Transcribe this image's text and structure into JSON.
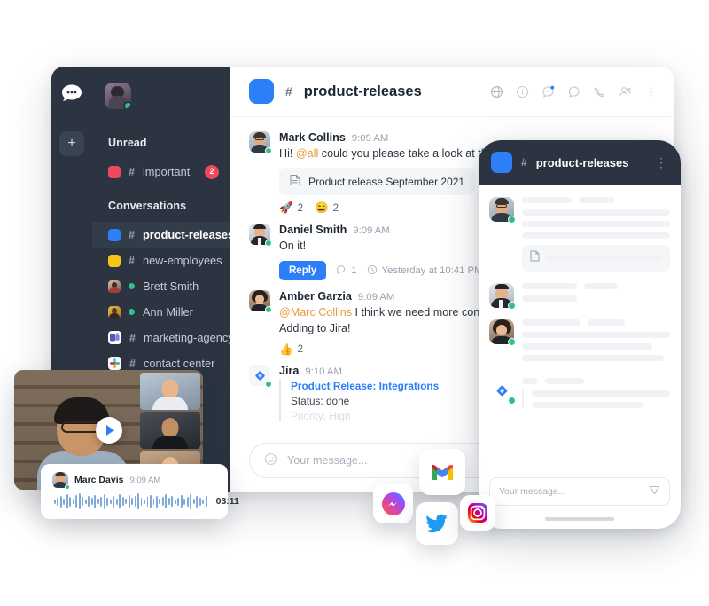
{
  "app": {
    "logo_icon": "rocket-chat-logo-icon",
    "add_button_label": "+",
    "user_avatar_name": "current-user-avatar",
    "presence": "online"
  },
  "sidebar": {
    "sections": [
      {
        "title": "Unread"
      },
      {
        "title": "Conversations"
      }
    ],
    "unread_items": [
      {
        "icon": "square-swatch",
        "color": "#f0485c",
        "prefix": "#",
        "label": "important",
        "badge": "2"
      }
    ],
    "conversation_items": [
      {
        "icon": "square-swatch",
        "color": "#2d7ff9",
        "prefix": "#",
        "label": "product-releases",
        "active": true
      },
      {
        "icon": "square-swatch",
        "color": "#f5c518",
        "prefix": "#",
        "label": "new-employees",
        "active": false
      },
      {
        "icon": "user-avatar",
        "prefix": "presence-dot",
        "label": "Brett Smith",
        "active": false
      },
      {
        "icon": "user-avatar",
        "prefix": "presence-dot",
        "label": "Ann Miller",
        "active": false
      },
      {
        "icon": "app-tile-teams",
        "prefix": "#",
        "label": "marketing-agency",
        "active": false
      },
      {
        "icon": "app-tile-slack",
        "prefix": "#",
        "label": "contact center",
        "active": false
      }
    ]
  },
  "channel_header": {
    "swatch_color": "#2d7ff9",
    "hash": "#",
    "title": "product-releases",
    "icons": [
      "globe-icon",
      "info-circle-icon",
      "chat-bubble-badge-icon",
      "chat-bubble-icon",
      "phone-icon",
      "people-icon",
      "more-vertical-icon"
    ]
  },
  "messages": [
    {
      "id": "m1",
      "author": "Mark Collins",
      "time": "9:09 AM",
      "presence": "online",
      "text_before": "Hi! ",
      "mention": "@all",
      "text_after": " could you please take a look at this",
      "attachment": {
        "icon": "document-icon",
        "label": "Product release September 2021"
      },
      "reactions": [
        {
          "emoji": "🚀",
          "name": "rocket-reaction",
          "count": "2"
        },
        {
          "emoji": "😄",
          "name": "smile-reaction",
          "count": "2"
        }
      ]
    },
    {
      "id": "m2",
      "author": "Daniel Smith",
      "time": "9:09 AM",
      "presence": "online",
      "text_before": "On it!",
      "footer": {
        "reply_label": "Reply",
        "thread_icon": "thread-icon",
        "thread_count": "1",
        "clock_icon": "clock-icon",
        "timestamp": "Yesterday at 10:41 PM"
      }
    },
    {
      "id": "m3",
      "author": "Amber Garzia",
      "time": "9:09 AM",
      "presence": "online",
      "mention": "@Marc Collins",
      "text_after": " I think we need more con",
      "second_line": "Adding to Jira!",
      "reactions": [
        {
          "emoji": "👍",
          "name": "thumbs-up-reaction",
          "count": "2"
        }
      ]
    },
    {
      "id": "m4",
      "author": "Jira",
      "time": "9:10 AM",
      "presence": "online",
      "avatar_icon": "jira-icon",
      "card": {
        "link": "Product Release: Integrations",
        "status": "Status: done",
        "priority": "Priority: High"
      }
    }
  ],
  "composer": {
    "emoji_icon": "emoji-smiley-icon",
    "placeholder": "Your message..."
  },
  "phone": {
    "header": {
      "swatch_color": "#2d7ff9",
      "hash": "#",
      "title": "product-releases",
      "more_icon": "more-vertical-icon"
    },
    "skeleton_messages": [
      {
        "avatar": "user-avatar-1",
        "presence": "online",
        "lines": 3,
        "attachment": true
      },
      {
        "avatar": "user-avatar-2",
        "presence": "online",
        "lines": 1,
        "attachment": false
      },
      {
        "avatar": "user-avatar-3",
        "presence": "online",
        "lines": 3,
        "attachment": false
      },
      {
        "avatar": "jira-icon",
        "presence": "online",
        "lines": 2,
        "attachment": false
      }
    ],
    "composer": {
      "placeholder": "Your message...",
      "send_icon": "send-icon"
    },
    "home_indicator": "home-indicator"
  },
  "video_call": {
    "play_icon": "play-button-icon",
    "main_participant": "video-participant-main",
    "thumbnails": [
      "video-participant-1",
      "video-participant-2",
      "video-participant-3"
    ]
  },
  "voice_message": {
    "author": "Marc Davis",
    "time": "9:09 AM",
    "duration": "03:11",
    "waveform": "audio-waveform"
  },
  "social_icons": [
    {
      "name": "gmail-icon",
      "label": "Gmail"
    },
    {
      "name": "messenger-icon",
      "label": "Messenger"
    },
    {
      "name": "twitter-icon",
      "label": "Twitter"
    },
    {
      "name": "instagram-icon",
      "label": "Instagram"
    }
  ],
  "colors": {
    "accent": "#2d7ff9",
    "dark": "#2b3440",
    "danger": "#f0485c",
    "online": "#2fc08c",
    "mention": "#e89c3c"
  }
}
